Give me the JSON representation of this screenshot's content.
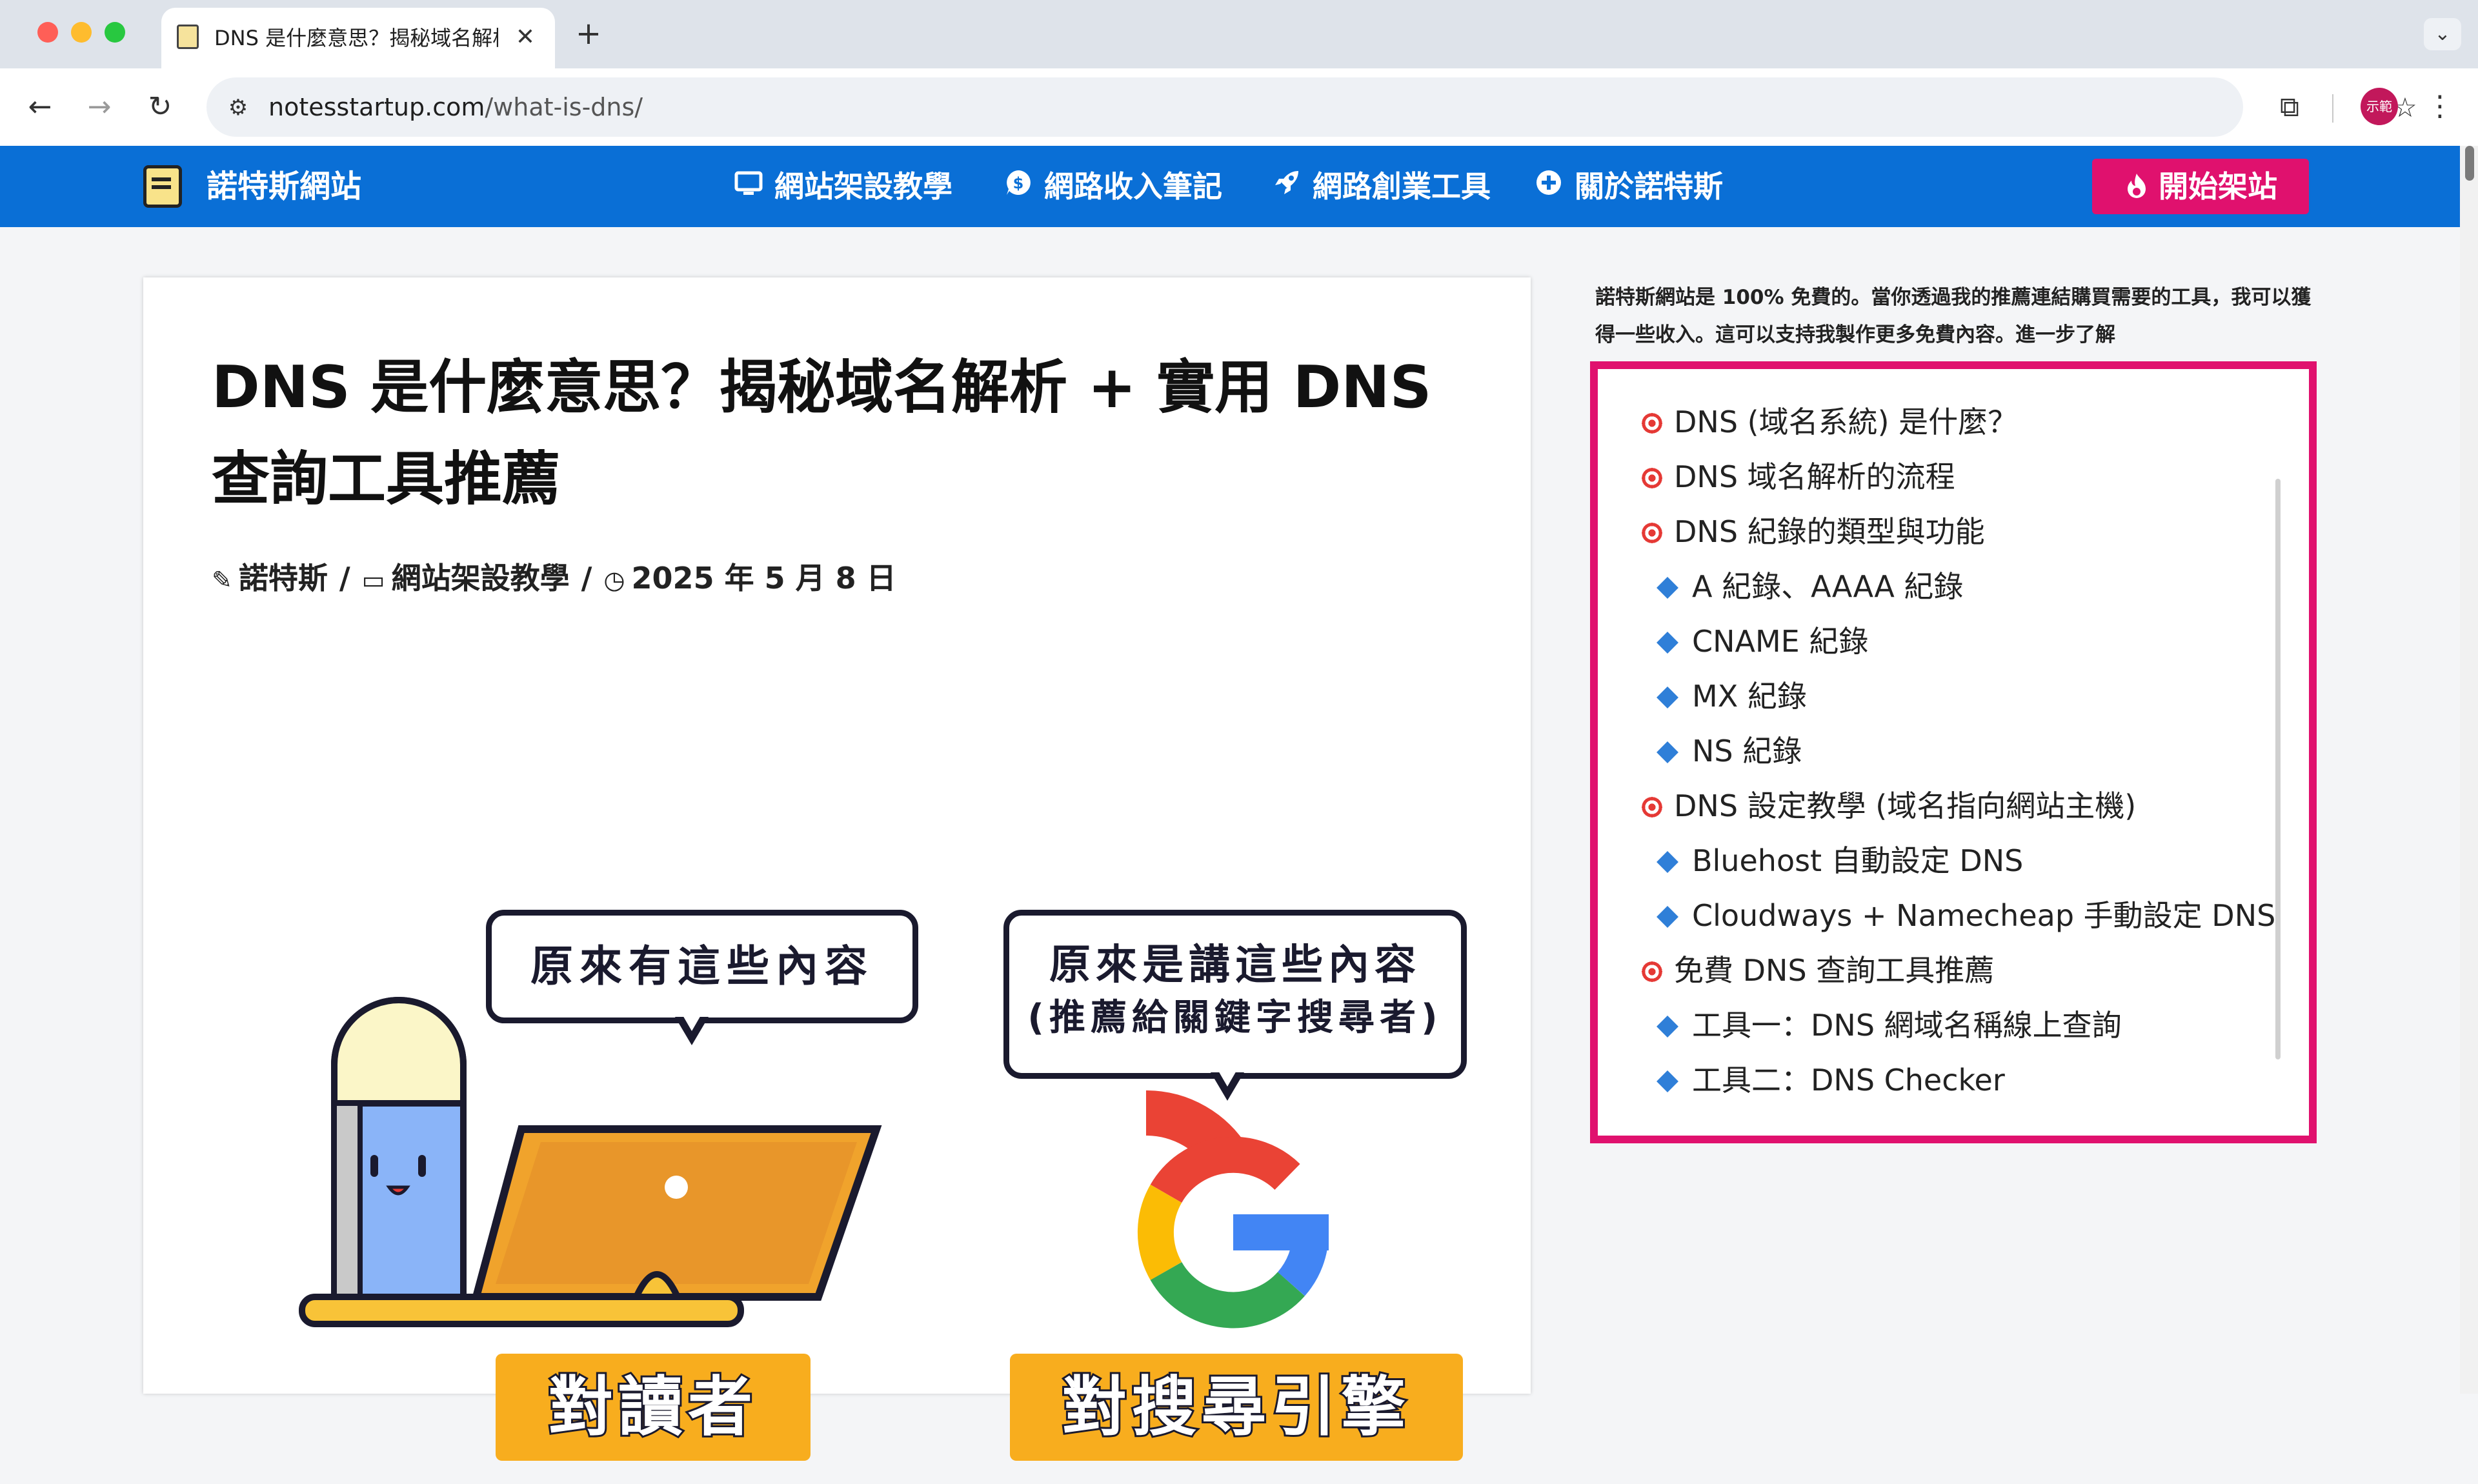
{
  "browser": {
    "tab_title": "DNS 是什麼意思？揭秘域名解析",
    "tab_close": "✕",
    "new_tab": "+",
    "url_host": "notesstartup.com",
    "url_path": "/what-is-dns/",
    "profile_label": "示範"
  },
  "site": {
    "name": "諾特斯網站",
    "menu": [
      {
        "label": "網站架設教學",
        "icon": "monitor-icon"
      },
      {
        "label": "網路收入筆記",
        "icon": "dollar-icon"
      },
      {
        "label": "網路創業工具",
        "icon": "rocket-icon"
      },
      {
        "label": "關於諾特斯",
        "icon": "plus-circle-icon"
      }
    ],
    "cta_label": "開始架站",
    "colors": {
      "nav_bg": "#0a6fd6",
      "accent": "#e0116e"
    }
  },
  "article": {
    "title": "DNS 是什麼意思？揭秘域名解析 + 實用 DNS 查詢工具推薦",
    "author": "諾特斯",
    "category": "網站架設教學",
    "date": "2025 年 5 月 8 日",
    "illustration": {
      "bubble_left": "原來有這些內容",
      "bubble_right_line1": "原來是講這些內容",
      "bubble_right_line2": "(推薦給關鍵字搜尋者)",
      "label_left": "對讀者",
      "label_right": "對搜尋引擎"
    }
  },
  "sidebar": {
    "affiliate_note": "諾特斯網站是 100% 免費的。當你透過我的推薦連結購買需要的工具，我可以獲得一些收入。這可以支持我製作更多免費內容。進一步了解",
    "toc": [
      {
        "label": "DNS (域名系統) 是什麼？",
        "level": 1
      },
      {
        "label": "DNS 域名解析的流程",
        "level": 1
      },
      {
        "label": "DNS 紀錄的類型與功能",
        "level": 1
      },
      {
        "label": "A 紀錄、AAAA 紀錄",
        "level": 2
      },
      {
        "label": "CNAME 紀錄",
        "level": 2
      },
      {
        "label": "MX 紀錄",
        "level": 2
      },
      {
        "label": "NS 紀錄",
        "level": 2
      },
      {
        "label": "DNS 設定教學 (域名指向網站主機)",
        "level": 1
      },
      {
        "label": "Bluehost 自動設定 DNS",
        "level": 2
      },
      {
        "label": "Cloudways + Namecheap 手動設定 DNS",
        "level": 2
      },
      {
        "label": "免費 DNS 查詢工具推薦",
        "level": 1
      },
      {
        "label": "工具一：DNS 網域名稱線上查詢",
        "level": 2
      },
      {
        "label": "工具二：DNS Checker",
        "level": 2
      }
    ]
  }
}
